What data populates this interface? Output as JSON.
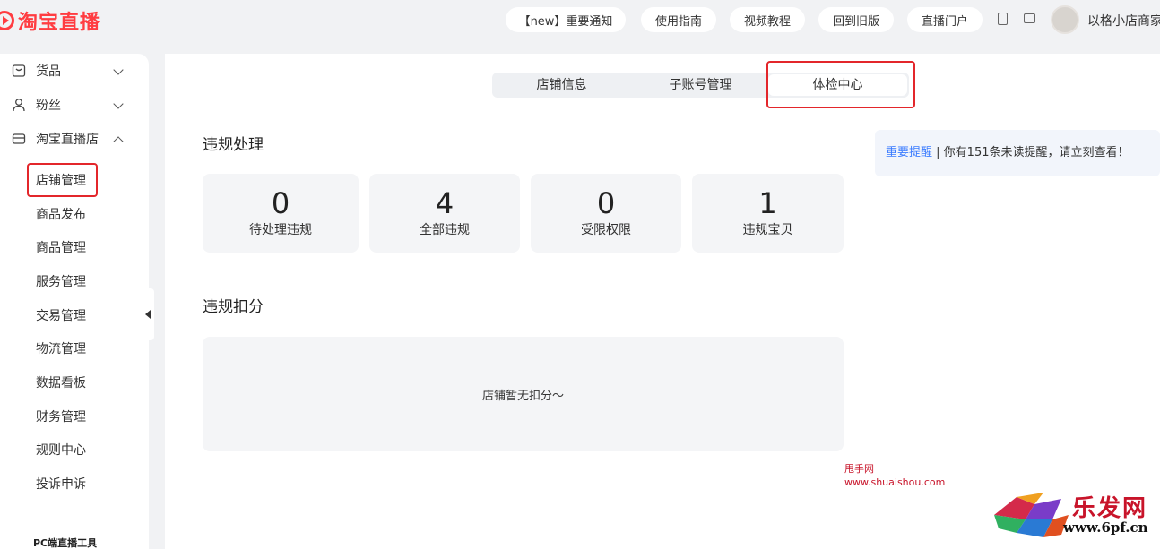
{
  "app": {
    "logo_text": "淘宝直播"
  },
  "header": {
    "buttons": [
      {
        "label": "【new】重要通知"
      },
      {
        "label": "使用指南"
      },
      {
        "label": "视频教程"
      },
      {
        "label": "回到旧版"
      },
      {
        "label": "直播门户"
      }
    ],
    "shop_name": "以格小店商家"
  },
  "sidebar": {
    "groups": [
      {
        "label": "货品",
        "icon": "bag-icon",
        "state": "collapsed"
      },
      {
        "label": "粉丝",
        "icon": "user-icon",
        "state": "collapsed"
      },
      {
        "label": "淘宝直播店",
        "icon": "store-icon",
        "state": "expanded"
      }
    ],
    "items": [
      {
        "label": "店铺管理",
        "active": true
      },
      {
        "label": "商品发布"
      },
      {
        "label": "商品管理"
      },
      {
        "label": "服务管理"
      },
      {
        "label": "交易管理"
      },
      {
        "label": "物流管理"
      },
      {
        "label": "数据看板"
      },
      {
        "label": "财务管理"
      },
      {
        "label": "规则中心"
      },
      {
        "label": "投诉申诉"
      }
    ],
    "footer_label": "PC端直播工具"
  },
  "tabs": [
    {
      "label": "店铺信息"
    },
    {
      "label": "子账号管理"
    },
    {
      "label": "体检中心",
      "active": true
    }
  ],
  "violation": {
    "title": "违规处理",
    "stats": [
      {
        "value": "0",
        "label": "待处理违规"
      },
      {
        "value": "4",
        "label": "全部违规"
      },
      {
        "value": "0",
        "label": "受限权限"
      },
      {
        "value": "1",
        "label": "违规宝贝"
      }
    ]
  },
  "deduction": {
    "title": "违规扣分",
    "empty_text": "店铺暂无扣分～"
  },
  "notice": {
    "link": "重要提醒",
    "separator": " | ",
    "text": "你有151条未读提醒，请立刻查看！"
  },
  "watermarks": {
    "site_name": "甩手网",
    "site_url": "www.shuaishou.com",
    "brand": "乐发网",
    "brand_url": "www.6pf.cn"
  },
  "colors": {
    "brand_red": "#ff3c41",
    "highlight_red": "#e3262b",
    "link_blue": "#3b7cff"
  }
}
